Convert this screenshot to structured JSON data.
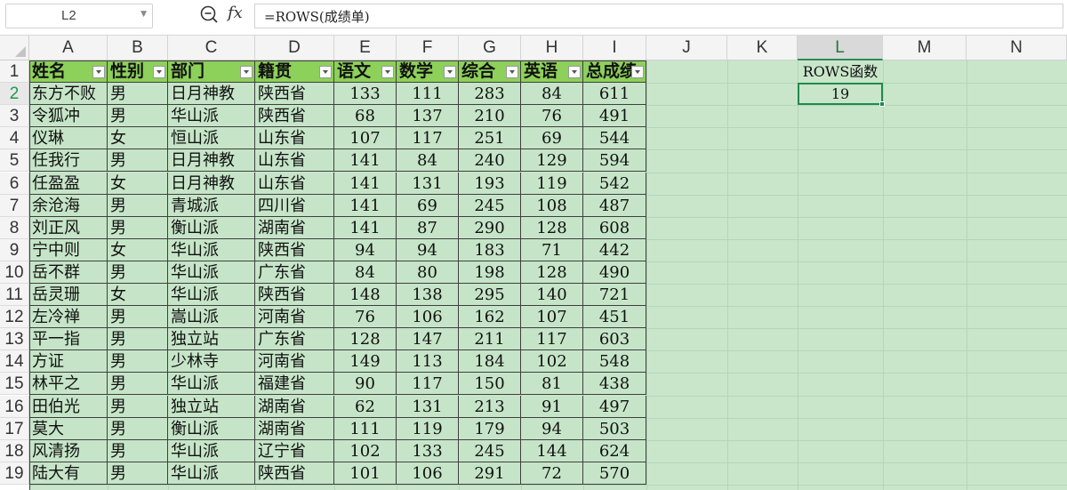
{
  "name_box": "L2",
  "formula_prefix": "fx",
  "formula": "=ROWS(成绩单)",
  "columns": [
    "A",
    "B",
    "C",
    "D",
    "E",
    "F",
    "G",
    "H",
    "I",
    "J",
    "K",
    "L",
    "M",
    "N"
  ],
  "selected_column": "L",
  "row_numbers": [
    "1",
    "2",
    "3",
    "4",
    "5",
    "6",
    "7",
    "8",
    "9",
    "10",
    "11",
    "12",
    "13",
    "14",
    "15",
    "16",
    "17",
    "18",
    "19"
  ],
  "selected_row": "2",
  "table": {
    "headers": [
      "姓名",
      "性别",
      "部门",
      "籍贯",
      "语文",
      "数学",
      "综合",
      "英语",
      "总成绩"
    ],
    "rows": [
      [
        "东方不败",
        "男",
        "日月神教",
        "陕西省",
        "133",
        "111",
        "283",
        "84",
        "611"
      ],
      [
        "令狐冲",
        "男",
        "华山派",
        "陕西省",
        "68",
        "137",
        "210",
        "76",
        "491"
      ],
      [
        "仪琳",
        "女",
        "恒山派",
        "山东省",
        "107",
        "117",
        "251",
        "69",
        "544"
      ],
      [
        "任我行",
        "男",
        "日月神教",
        "山东省",
        "141",
        "84",
        "240",
        "129",
        "594"
      ],
      [
        "任盈盈",
        "女",
        "日月神教",
        "山东省",
        "141",
        "131",
        "193",
        "119",
        "542"
      ],
      [
        "余沧海",
        "男",
        "青城派",
        "四川省",
        "141",
        "69",
        "245",
        "108",
        "487"
      ],
      [
        "刘正风",
        "男",
        "衡山派",
        "湖南省",
        "141",
        "87",
        "290",
        "128",
        "608"
      ],
      [
        "宁中则",
        "女",
        "华山派",
        "陕西省",
        "94",
        "94",
        "183",
        "71",
        "442"
      ],
      [
        "岳不群",
        "男",
        "华山派",
        "广东省",
        "84",
        "80",
        "198",
        "128",
        "490"
      ],
      [
        "岳灵珊",
        "女",
        "华山派",
        "陕西省",
        "148",
        "138",
        "295",
        "140",
        "721"
      ],
      [
        "左冷禅",
        "男",
        "嵩山派",
        "河南省",
        "76",
        "106",
        "162",
        "107",
        "451"
      ],
      [
        "平一指",
        "男",
        "独立站",
        "广东省",
        "128",
        "147",
        "211",
        "117",
        "603"
      ],
      [
        "方证",
        "男",
        "少林寺",
        "河南省",
        "149",
        "113",
        "184",
        "102",
        "548"
      ],
      [
        "林平之",
        "男",
        "华山派",
        "福建省",
        "90",
        "117",
        "150",
        "81",
        "438"
      ],
      [
        "田伯光",
        "男",
        "独立站",
        "湖南省",
        "62",
        "131",
        "213",
        "91",
        "497"
      ],
      [
        "莫大",
        "男",
        "衡山派",
        "湖南省",
        "111",
        "119",
        "179",
        "94",
        "503"
      ],
      [
        "风清扬",
        "男",
        "华山派",
        "辽宁省",
        "102",
        "133",
        "245",
        "144",
        "624"
      ],
      [
        "陆大有",
        "男",
        "华山派",
        "陕西省",
        "101",
        "106",
        "291",
        "72",
        "570"
      ]
    ]
  },
  "l_column": {
    "title": "ROWS函数",
    "value": "19"
  },
  "colors": {
    "header_fill": "#8dd05a",
    "sheet_fill": "#c9e6cb",
    "selection": "#1f8a4c"
  }
}
